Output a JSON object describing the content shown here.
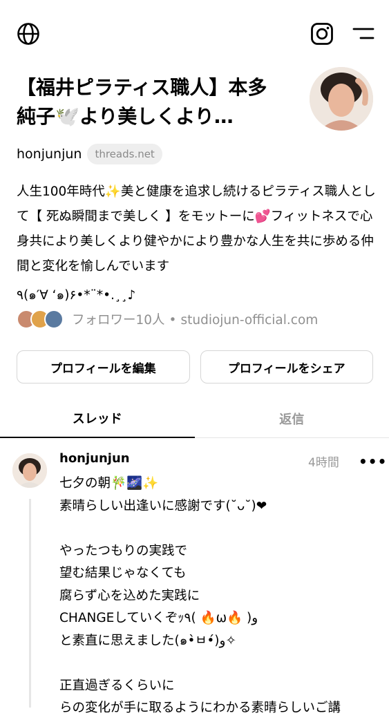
{
  "header": {
    "globe_icon": "globe-icon",
    "instagram_icon": "instagram-icon",
    "menu_icon": "menu-icon"
  },
  "profile": {
    "name": "【福井ピラティス職人】本多 純子🕊️より美しくより…",
    "handle": "honjunjun",
    "domain_badge": "threads.net",
    "bio_lines": [
      "人生100年時代✨美と健康を追求し続けるピラティス職人として【 死ぬ瞬間まで美しく 】をモットーに💕フィットネスで心身共により美しくより健やかにより豊かな人生を共に歩める仲間と変化を愉しんでいます",
      "٩(๑′∀ ‘๑)۶•*¨*•.¸¸♪"
    ],
    "followers": "フォロワー10人",
    "separator": "•",
    "website": "studiojun-official.com"
  },
  "buttons": {
    "edit_profile": "プロフィールを編集",
    "share_profile": "プロフィールをシェア"
  },
  "tabs": [
    {
      "label": "スレッド",
      "active": true
    },
    {
      "label": "返信",
      "active": false
    }
  ],
  "post": {
    "username": "honjunjun",
    "time": "4時間",
    "more": "•••",
    "text": "七夕の朝🎋🌌✨\n素晴らしい出逢いに感謝です(˘ᴗ˘)❤\n\nやったつもりの実践で\n望む結果じゃなくても\n腐らず心を込めた実践に\nCHANGEしていくぞｯ٩( 🔥ω🔥 )و\nと素直に思えました(๑•̀ㅂ•́)و✧\n\n正直過ぎるくらいに\nらの変化が手に取るようにわかる素晴らしいご講"
  },
  "colors": {
    "text": "#000000",
    "secondary": "#999999",
    "border": "#d5d5d5",
    "badge_bg": "#eeeeee"
  }
}
